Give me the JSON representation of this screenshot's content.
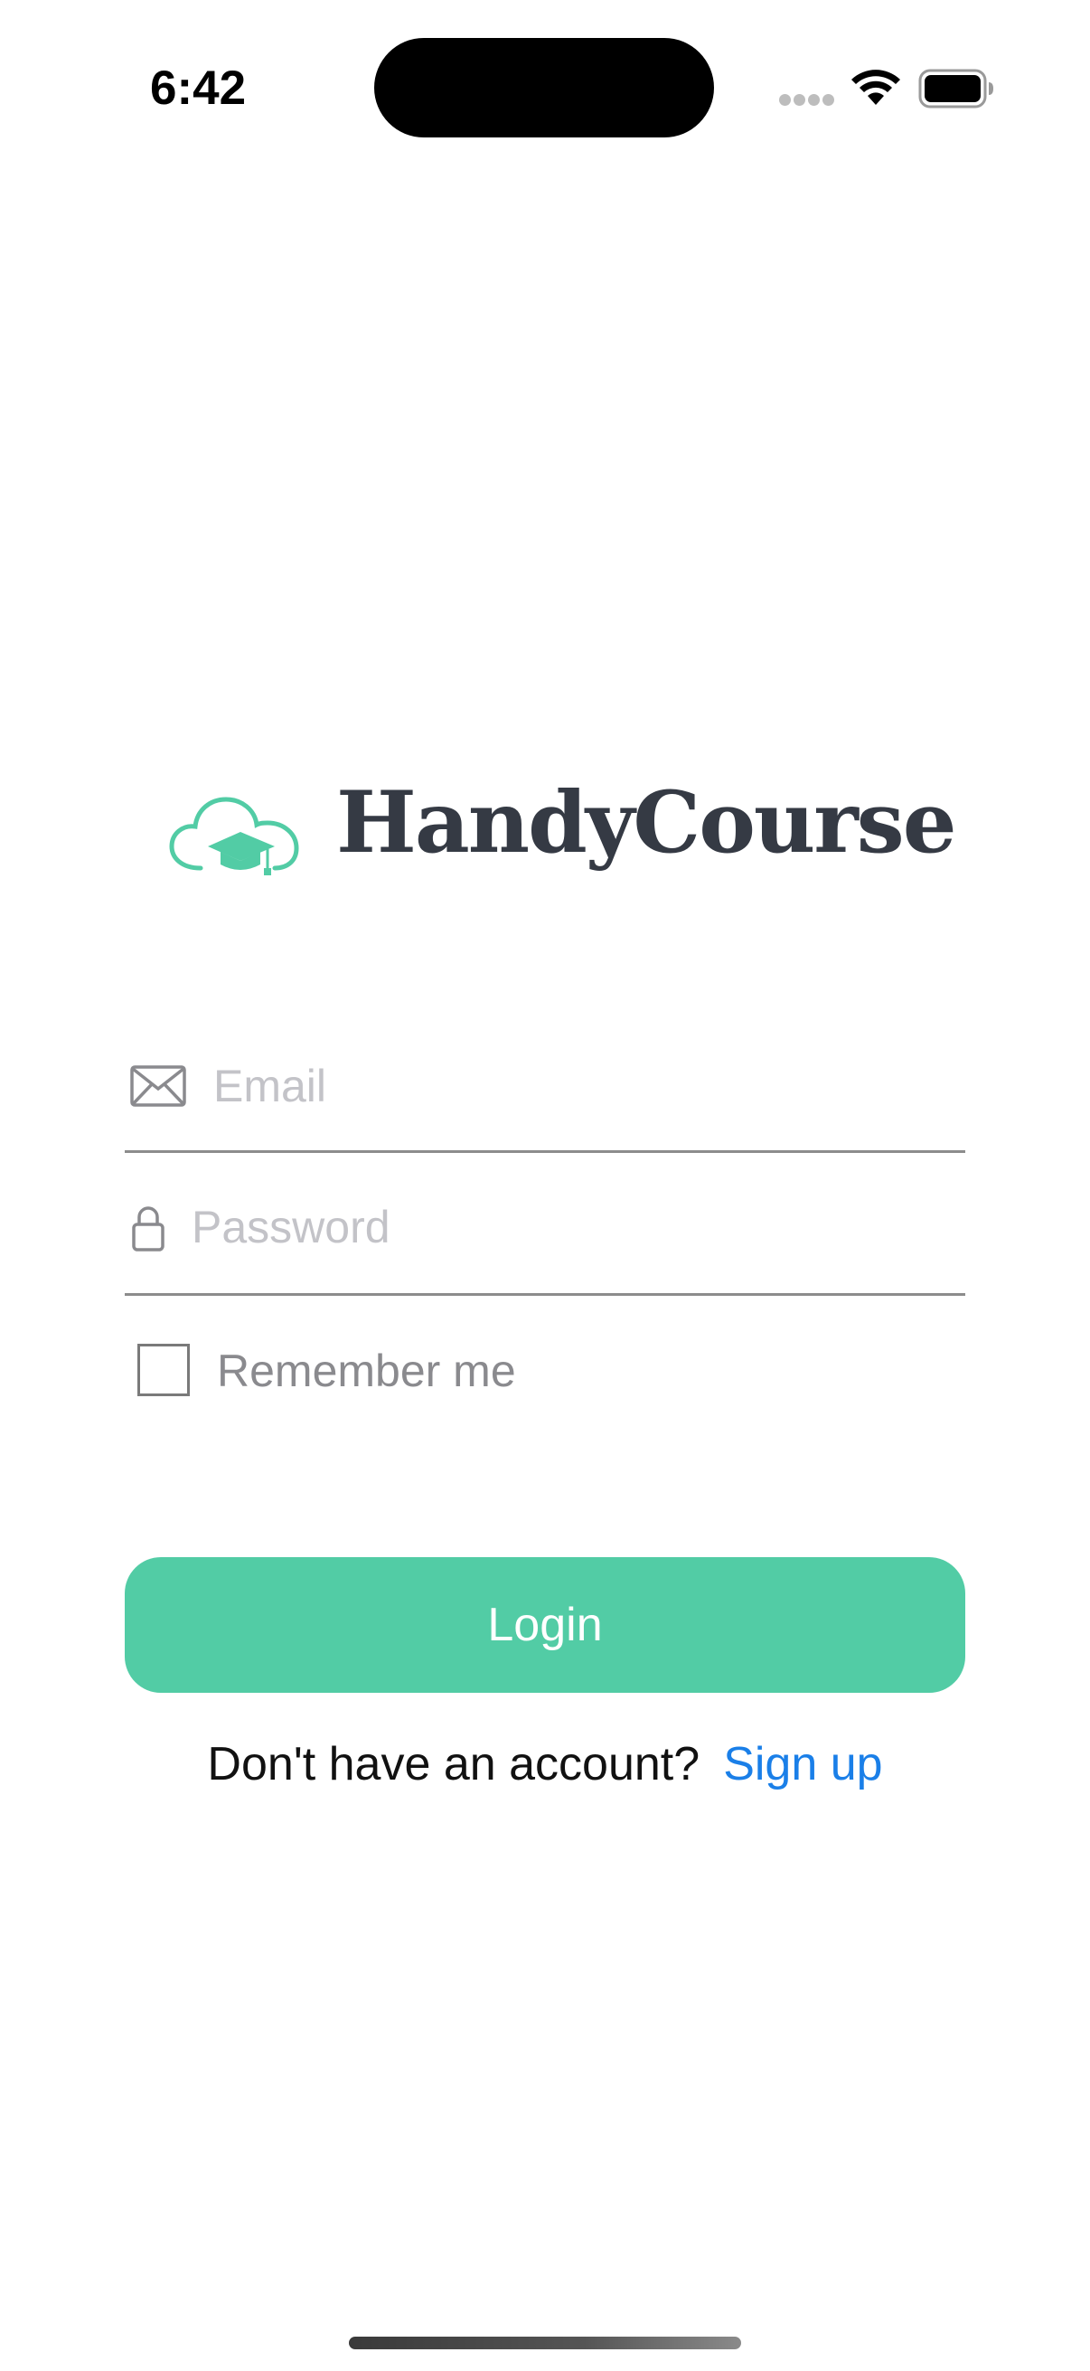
{
  "status_bar": {
    "time": "6:42"
  },
  "brand": {
    "name": "HandyCourse",
    "logo_icon": "cloud-graduation-cap-icon",
    "accent_color": "#52cca5",
    "text_color": "#353a44"
  },
  "form": {
    "email": {
      "icon": "envelope-icon",
      "placeholder": "Email",
      "value": ""
    },
    "password": {
      "icon": "lock-icon",
      "placeholder": "Password",
      "value": ""
    },
    "remember_me": {
      "label": "Remember me",
      "checked": false
    },
    "login_label": "Login"
  },
  "signup": {
    "prompt": "Don't have an account?",
    "link_label": "Sign up",
    "link_color": "#1a7fe8"
  }
}
